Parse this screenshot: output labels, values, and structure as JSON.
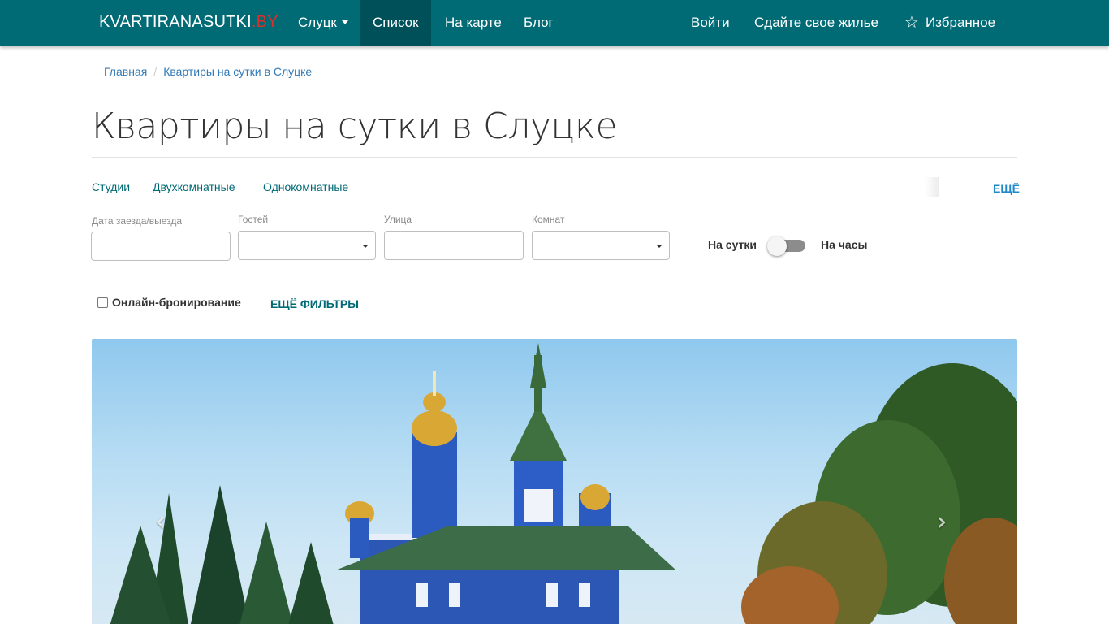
{
  "nav": {
    "brand_main": "KVARTIRANASUTKI",
    "brand_suffix": ".BY",
    "city": "Слуцк",
    "list": "Список",
    "map": "На карте",
    "blog": "Блог",
    "login": "Войти",
    "rent_out": "Сдайте свое жилье",
    "favorites": "Избранное",
    "favorites_icon": "star-outline-icon"
  },
  "breadcrumb": {
    "home": "Главная",
    "current": "Квартиры на сутки в Слуцке"
  },
  "page": {
    "title": "Квартиры на сутки в Слуцке"
  },
  "quick_links": {
    "items": [
      "Студии",
      "Двухкомнатные",
      "Однокомнатные"
    ],
    "more": "ЕЩЁ"
  },
  "filters": {
    "dates_label": "Дата заезда/выезда",
    "guests_label": "Гостей",
    "street_label": "Улица",
    "rooms_label": "Комнат",
    "dates_value": "",
    "guests_value": "",
    "street_value": "",
    "rooms_value": "",
    "mode_day": "На сутки",
    "mode_hours": "На часы",
    "online_booking": "Онлайн-бронирование",
    "more_filters": "ЕЩЁ ФИЛЬТРЫ"
  },
  "carousel": {
    "prev_glyph": "‹",
    "next_glyph": "›"
  },
  "colors": {
    "navbar": "#006a75",
    "navbar_active": "#00505a",
    "link": "#337ab7",
    "accent_red": "#d9302c"
  }
}
